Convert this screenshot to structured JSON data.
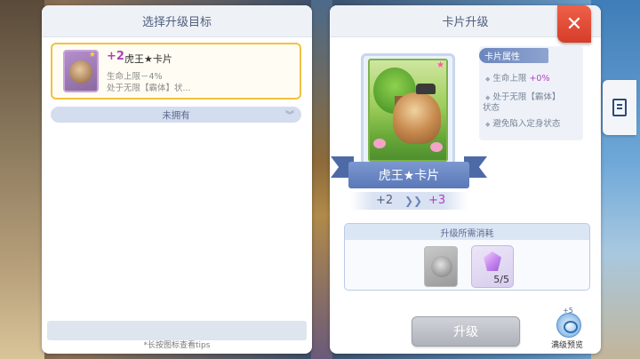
{
  "left_panel": {
    "title": "选择升级目标",
    "item": {
      "level": "+2",
      "name": "虎王★卡片",
      "desc_line1": "生命上限－4%",
      "desc_line2": "处于无限【霸体】状..."
    },
    "unowned_label": "未拥有",
    "footer_tip": "*长按图标查看tips"
  },
  "right_panel": {
    "title": "卡片升级",
    "close_label": "✕",
    "card_name": "虎王★卡片",
    "level_from": "+2",
    "level_arrow": "❯❯",
    "level_to": "+3",
    "attributes": {
      "header": "卡片属性",
      "line1_prefix": "生命上限",
      "line1_value": "+0%",
      "line2a": "处于无限【霸体】",
      "line2b": "状态",
      "line3": "避免陷入定身状态"
    },
    "cost": {
      "header": "升级所需消耗",
      "material_count": "5/5"
    },
    "upgrade_button": "升级",
    "preview": {
      "plus": "+5",
      "label": "满级预览"
    }
  },
  "colors": {
    "highlight": "#b23fbf",
    "close_button": "#d53d2a",
    "selected_border": "#f2c23c"
  },
  "icons": [
    "star-icon",
    "chevron-down-icon",
    "close-icon",
    "document-icon",
    "gem-icon",
    "eye-icon",
    "double-arrow-icon"
  ]
}
